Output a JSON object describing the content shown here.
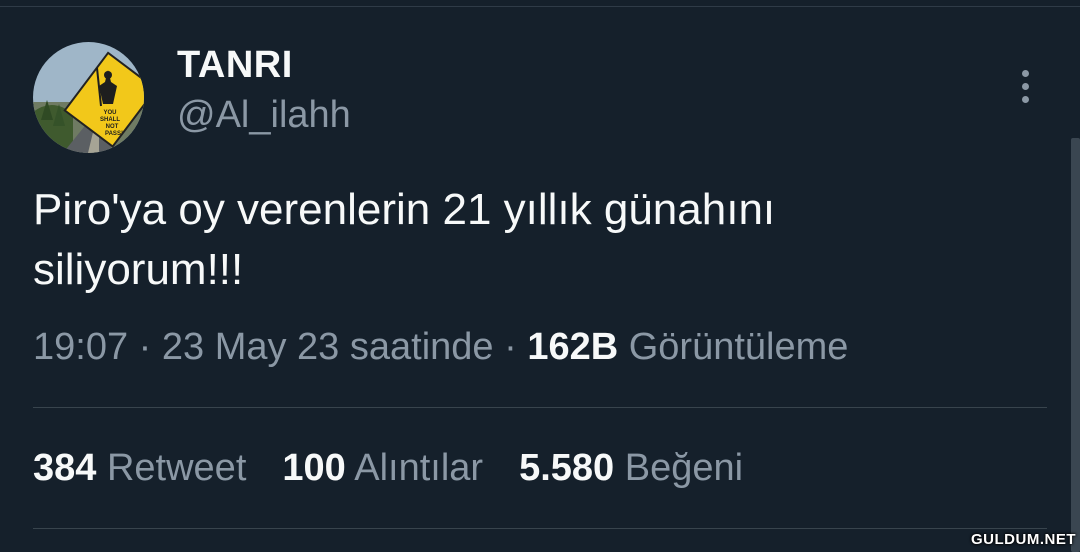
{
  "user": {
    "display_name": "TANRI",
    "handle": "@Al_ilahh",
    "avatar_sign_text": "YOU SHALL NOT PASS!"
  },
  "tweet": {
    "text_line1": "Piro'ya oy verenlerin 21 yıllık günahını",
    "text_line2": "siliyorum!!!",
    "time": "19:07",
    "date": "23 May 23 saatinde",
    "separator": "·",
    "views_count": "162B",
    "views_label": "Görüntüleme"
  },
  "stats": [
    {
      "count": "384",
      "label": "Retweet"
    },
    {
      "count": "100",
      "label": "Alıntılar"
    },
    {
      "count": "5.580",
      "label": "Beğeni"
    }
  ],
  "watermark": "GULDUM.NET",
  "colors": {
    "background": "#15202b",
    "primary_text": "#f7f9f9",
    "secondary_text": "#8b98a5",
    "divider": "#38444d"
  }
}
